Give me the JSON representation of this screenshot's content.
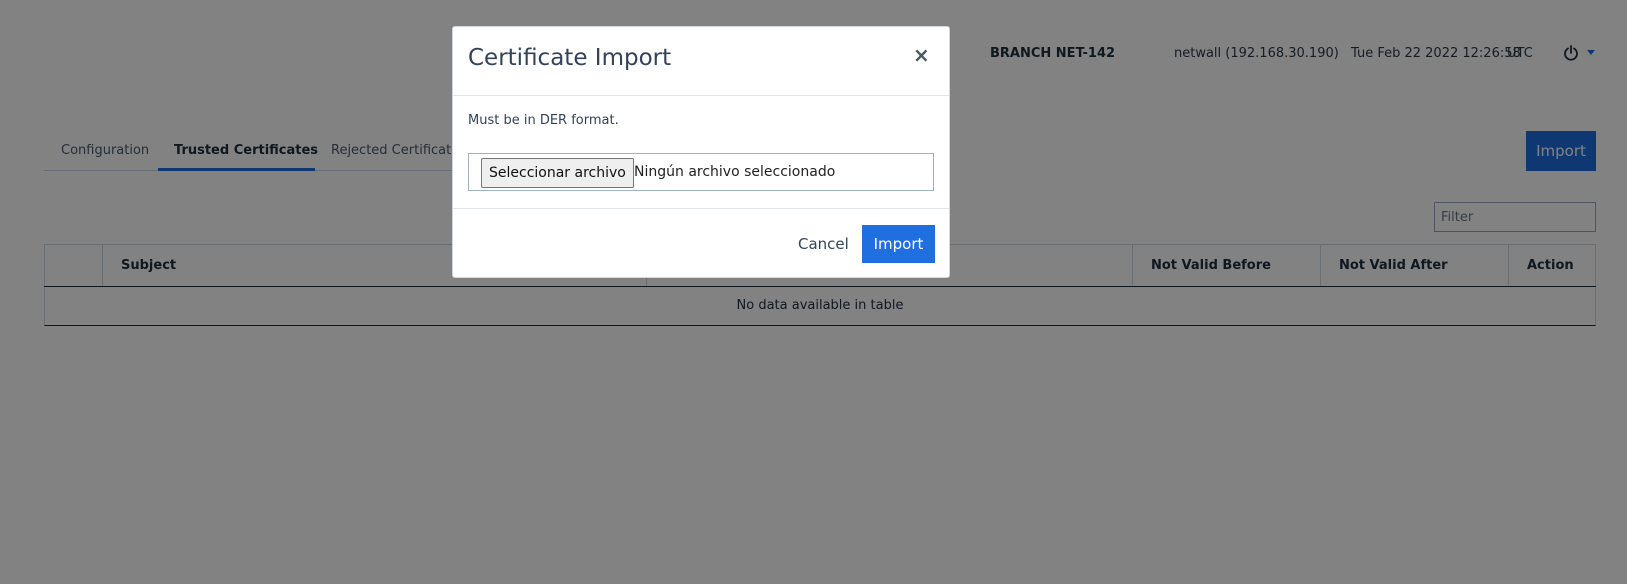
{
  "header": {
    "device_name": "BRANCH NET-142",
    "host": "netwall (192.168.30.190)",
    "datetime": "Tue Feb 22 2022 12:26:58",
    "timezone": "UTC",
    "power_icon": "power-icon",
    "menu_icon": "chevron-down-icon"
  },
  "tabs": [
    {
      "label": "Configuration",
      "active": false
    },
    {
      "label": "Trusted Certificates",
      "active": true
    },
    {
      "label": "Rejected Certificates",
      "active": false
    }
  ],
  "toolbar": {
    "import_label": "Import",
    "filter_placeholder": "Filter"
  },
  "table": {
    "columns": [
      "",
      "Subject",
      "",
      "Not Valid Before",
      "Not Valid After",
      "Action"
    ],
    "empty_message": "No data available in table"
  },
  "modal": {
    "title": "Certificate Import",
    "close_symbol": "×",
    "help_text": "Must be in DER format.",
    "file_button_label": "Seleccionar archivo",
    "file_status": "Ningún archivo seleccionado",
    "cancel_label": "Cancel",
    "import_label": "Import"
  },
  "colors": {
    "accent": "#1f6fe0",
    "overlay": "rgba(0,0,0,0.49)"
  }
}
